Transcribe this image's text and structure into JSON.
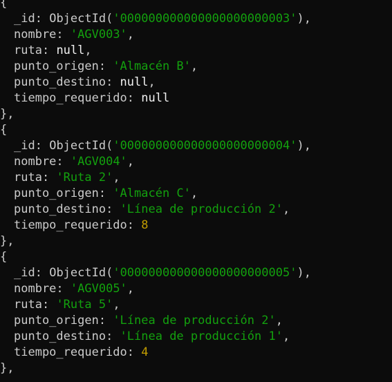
{
  "documents": [
    {
      "open": "{",
      "close": "},",
      "fields": [
        {
          "key": "_id",
          "type": "objectid",
          "fn": "ObjectId(",
          "value": "'000000000000000000000003'",
          "fn_close": ")",
          "comma": ","
        },
        {
          "key": "nombre",
          "type": "string",
          "value": "'AGV003'",
          "comma": ","
        },
        {
          "key": "ruta",
          "type": "null",
          "value": "null",
          "comma": ","
        },
        {
          "key": "punto_origen",
          "type": "string",
          "value": "'Almacén B'",
          "comma": ","
        },
        {
          "key": "punto_destino",
          "type": "null",
          "value": "null",
          "comma": ","
        },
        {
          "key": "tiempo_requerido",
          "type": "null",
          "value": "null",
          "comma": ""
        }
      ]
    },
    {
      "open": "{",
      "close": "},",
      "fields": [
        {
          "key": "_id",
          "type": "objectid",
          "fn": "ObjectId(",
          "value": "'000000000000000000000004'",
          "fn_close": ")",
          "comma": ","
        },
        {
          "key": "nombre",
          "type": "string",
          "value": "'AGV004'",
          "comma": ","
        },
        {
          "key": "ruta",
          "type": "string",
          "value": "'Ruta 2'",
          "comma": ","
        },
        {
          "key": "punto_origen",
          "type": "string",
          "value": "'Almacén C'",
          "comma": ","
        },
        {
          "key": "punto_destino",
          "type": "string",
          "value": "'Línea de producción 2'",
          "comma": ","
        },
        {
          "key": "tiempo_requerido",
          "type": "number",
          "value": "8",
          "comma": ""
        }
      ]
    },
    {
      "open": "{",
      "close": "},",
      "fields": [
        {
          "key": "_id",
          "type": "objectid",
          "fn": "ObjectId(",
          "value": "'000000000000000000000005'",
          "fn_close": ")",
          "comma": ","
        },
        {
          "key": "nombre",
          "type": "string",
          "value": "'AGV005'",
          "comma": ","
        },
        {
          "key": "ruta",
          "type": "string",
          "value": "'Ruta 5'",
          "comma": ","
        },
        {
          "key": "punto_origen",
          "type": "string",
          "value": "'Línea de producción 2'",
          "comma": ","
        },
        {
          "key": "punto_destino",
          "type": "string",
          "value": "'Línea de producción 1'",
          "comma": ","
        },
        {
          "key": "tiempo_requerido",
          "type": "number",
          "value": "4",
          "comma": ""
        }
      ]
    }
  ],
  "colors": {
    "background": "#0c0c0c",
    "text": "#cccccc",
    "string": "#13a10e",
    "number": "#c19c00",
    "null": "#f2f2f2"
  }
}
